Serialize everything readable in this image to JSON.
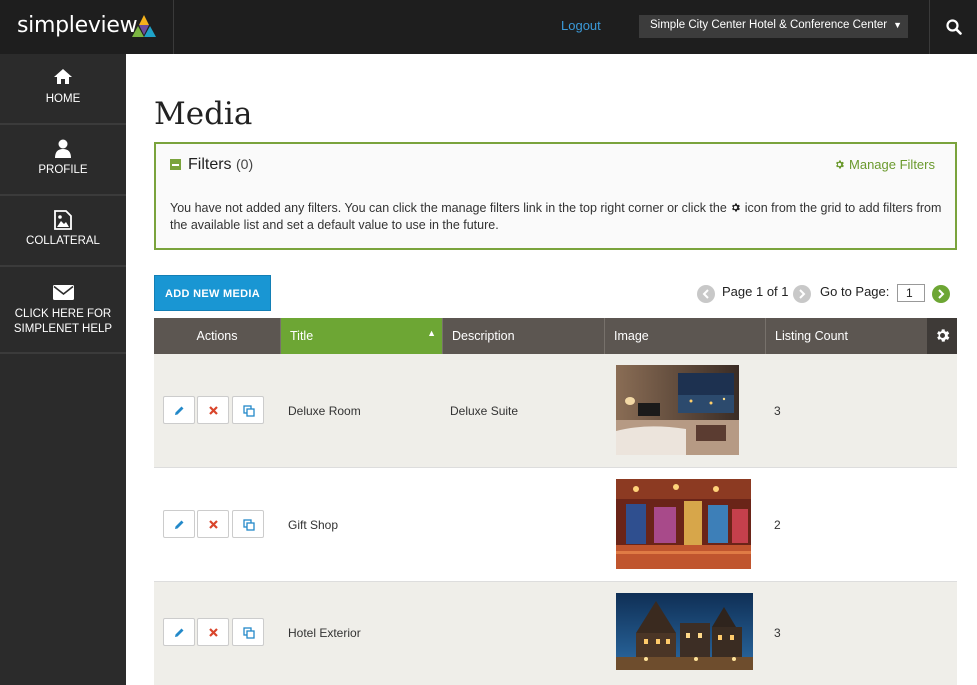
{
  "brand": {
    "name": "simpleview"
  },
  "header": {
    "logout_label": "Logout",
    "property_select": "Simple City Center Hotel & Conference Center"
  },
  "sidebar": {
    "items": [
      {
        "label": "HOME",
        "icon": "home-icon"
      },
      {
        "label": "PROFILE",
        "icon": "user-icon"
      },
      {
        "label": "COLLATERAL",
        "icon": "image-file-icon"
      },
      {
        "label_line1": "CLICK HERE FOR",
        "label_line2": "SIMPLENET HELP",
        "icon": "envelope-icon"
      }
    ]
  },
  "main": {
    "title": "Media",
    "filters": {
      "title": "Filters",
      "count": "(0)",
      "manage_label": "Manage Filters",
      "message_before_icon": "You have not added any filters. You can click the manage filters link in the top right corner or click the",
      "message_after_icon": "icon from the grid to add filters from the available list and set a default value to use in the future."
    },
    "add_button": "ADD NEW MEDIA",
    "pagination": {
      "page_text": "Page 1 of 1",
      "goto_label": "Go to Page:",
      "goto_value": "1"
    },
    "table": {
      "columns": [
        "Actions",
        "Title",
        "Description",
        "Image",
        "Listing Count"
      ],
      "sorted_column": "Title",
      "rows": [
        {
          "title": "Deluxe Room",
          "description": "Deluxe Suite",
          "image": "hotel-room-photo",
          "listing_count": "3"
        },
        {
          "title": "Gift Shop",
          "description": "",
          "image": "gift-shop-photo",
          "listing_count": "2"
        },
        {
          "title": "Hotel Exterior",
          "description": "",
          "image": "hotel-exterior-night-photo",
          "listing_count": "3"
        }
      ]
    }
  },
  "colors": {
    "accent_green": "#6da634",
    "button_blue": "#1996d3",
    "link_blue": "#3b9ad9",
    "topbar": "#1e1e1e",
    "sidebar": "#2b2b2b",
    "table_header": "#5c5651"
  }
}
